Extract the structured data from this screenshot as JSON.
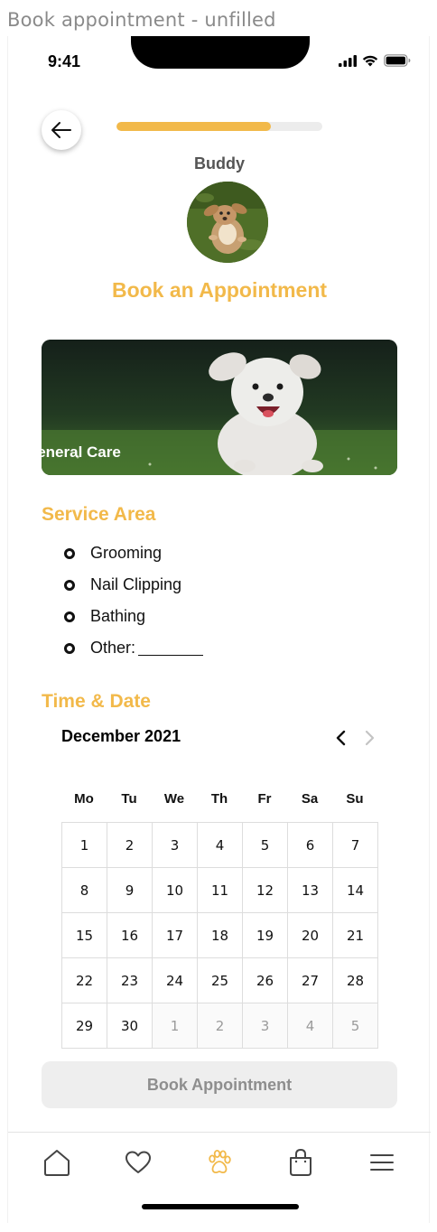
{
  "frame_title": "Book appointment - unfilled",
  "status_bar": {
    "time": "9:41"
  },
  "progress": {
    "value": 0.75
  },
  "pet": {
    "name": "Buddy"
  },
  "page_title": "Book an Appointment",
  "service_card": {
    "label": "General Care"
  },
  "service_area": {
    "title": "Service Area",
    "options": [
      "Grooming",
      "Nail Clipping",
      "Bathing",
      "Other:"
    ]
  },
  "time_date": {
    "title": "Time & Date",
    "month": "December 2021",
    "weekdays": [
      "Mo",
      "Tu",
      "We",
      "Th",
      "Fr",
      "Sa",
      "Su"
    ],
    "days": [
      [
        "1",
        "2",
        "3",
        "4",
        "5",
        "6",
        "7"
      ],
      [
        "8",
        "9",
        "10",
        "11",
        "12",
        "13",
        "14"
      ],
      [
        "15",
        "16",
        "17",
        "18",
        "19",
        "20",
        "21"
      ],
      [
        "22",
        "23",
        "24",
        "25",
        "26",
        "27",
        "28"
      ],
      [
        "29",
        "30",
        "1",
        "2",
        "3",
        "4",
        "5"
      ]
    ]
  },
  "book_button": {
    "label": "Book Appointment"
  },
  "tabbar": {
    "items": [
      "home-icon",
      "heart-icon",
      "paw-icon",
      "shopping-bag-icon",
      "menu-icon"
    ],
    "active": "paw-icon"
  },
  "colors": {
    "accent": "#f2b94a",
    "disabled_bg": "#eeeeee",
    "disabled_text": "#8e8e8e"
  }
}
